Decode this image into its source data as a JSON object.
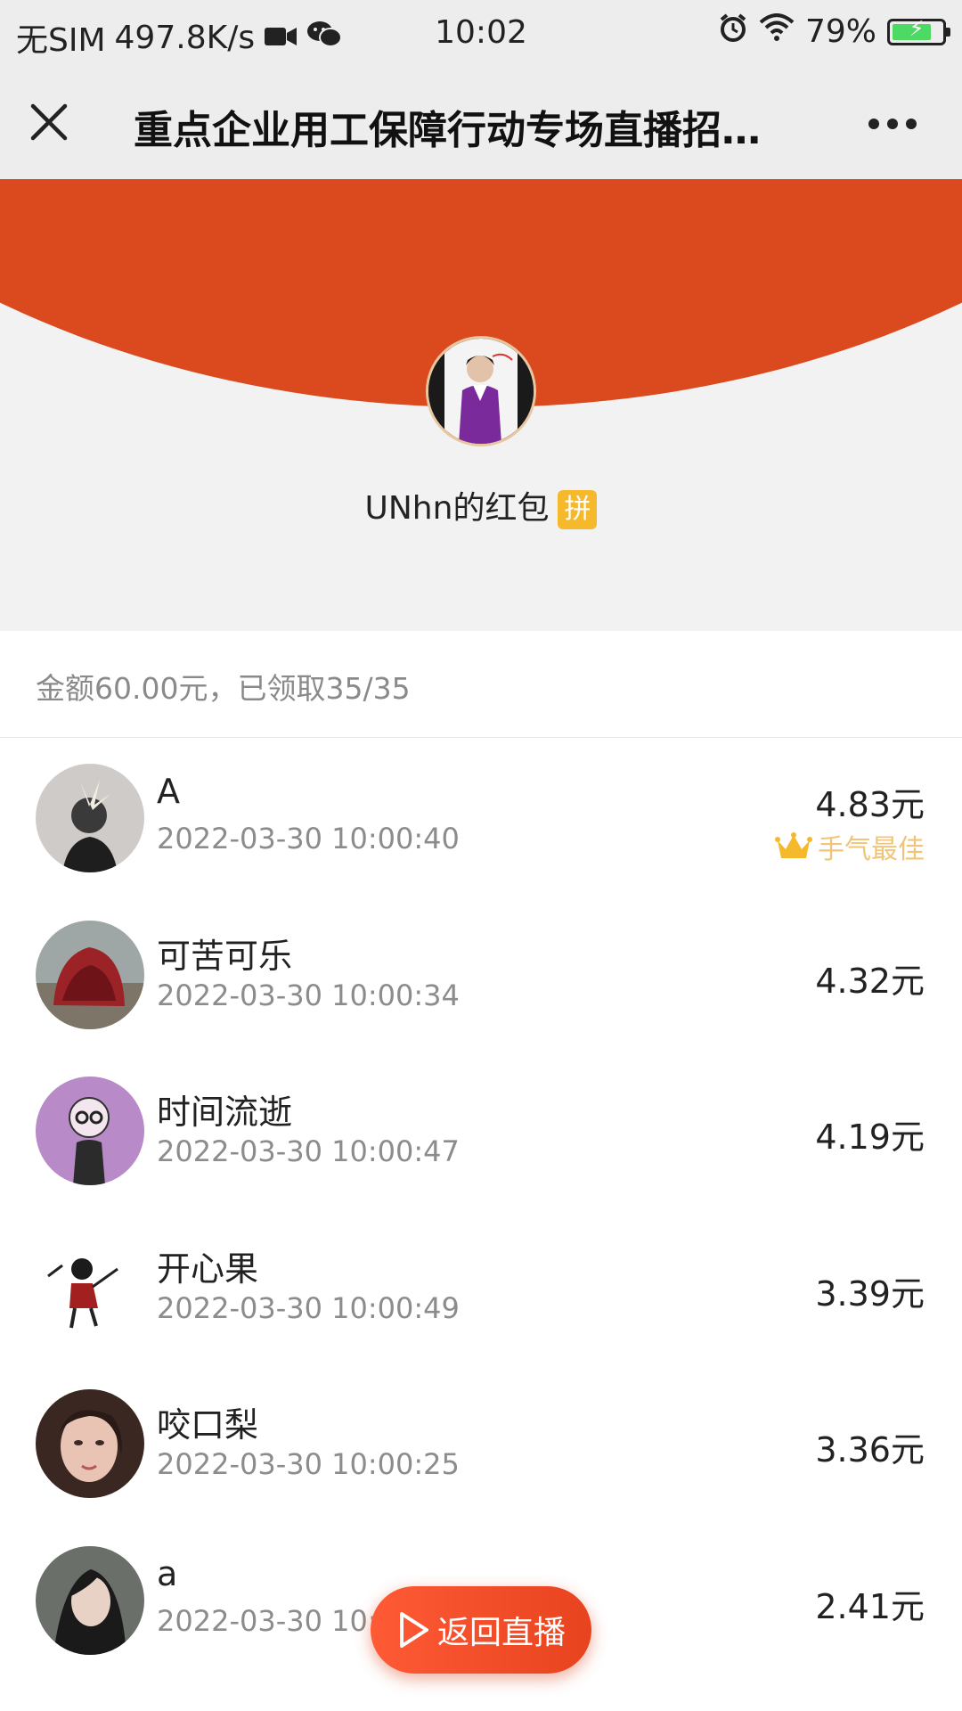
{
  "status_bar": {
    "carrier": "无SIM",
    "speed": "497.8K/s",
    "time": "10:02",
    "battery_percent": "79%",
    "battery_level": 0.79,
    "icons": [
      "video-icon",
      "wechat-icon",
      "alarm-icon",
      "wifi-icon",
      "battery-icon"
    ]
  },
  "nav": {
    "title": "重点企业用工保障行动专场直播招…",
    "icons": [
      "close-icon",
      "more-icon"
    ]
  },
  "header": {
    "sender_label": "UNhn的红包",
    "badge": "拼",
    "colors": {
      "arc": "#db4a1e",
      "badge": "#f6b92c",
      "background": "#f2f2f2"
    }
  },
  "summary": {
    "text": "金额60.00元，已领取35/35"
  },
  "records": [
    {
      "name": "A",
      "time": "2022-03-30 10:00:40",
      "amount": "4.83元",
      "best_label": "手气最佳"
    },
    {
      "name": "可苦可乐",
      "time": "2022-03-30 10:00:34",
      "amount": "4.32元"
    },
    {
      "name": "时间流逝",
      "time": "2022-03-30 10:00:47",
      "amount": "4.19元"
    },
    {
      "name": "开心果",
      "time": "2022-03-30 10:00:49",
      "amount": "3.39元"
    },
    {
      "name": "咬口梨",
      "time": "2022-03-30 10:00:25",
      "amount": "3.36元"
    },
    {
      "name": "a",
      "time": "2022-03-30 10:",
      "amount": "2.41元"
    }
  ],
  "floating_button": {
    "label": "返回直播",
    "icon": "play-icon",
    "color_start": "#ff5a36",
    "color_end": "#e8431f"
  }
}
